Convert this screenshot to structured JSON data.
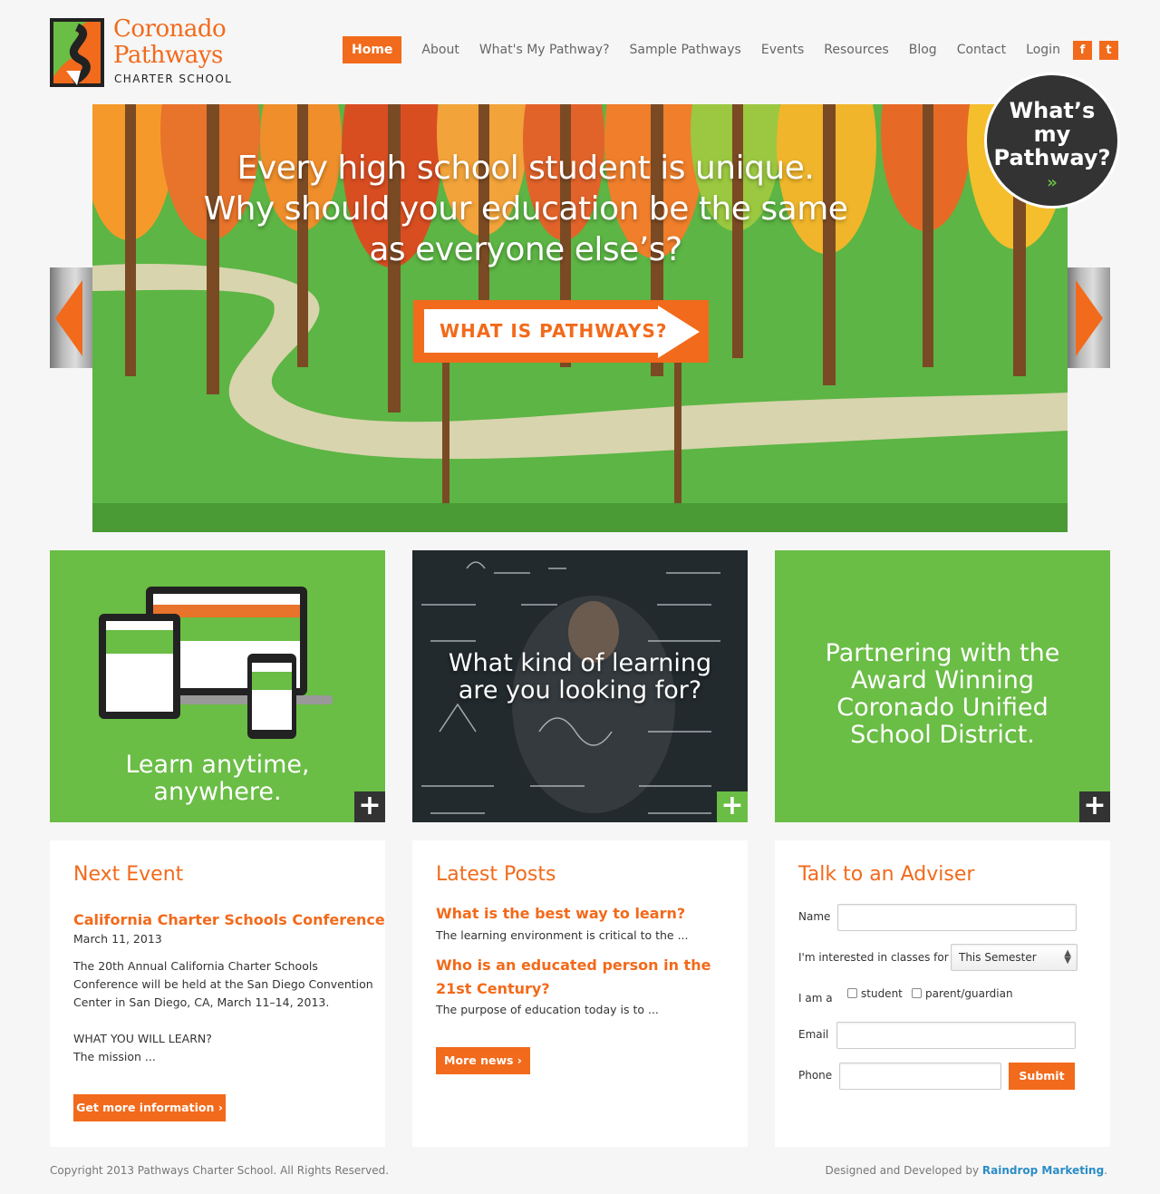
{
  "logo": {
    "line1": "Coronado",
    "line2": "Pathways",
    "line3": "CHARTER SCHOOL"
  },
  "nav": {
    "items": [
      "Home",
      "About",
      "What's My Pathway?",
      "Sample Pathways",
      "Events",
      "Resources",
      "Blog",
      "Contact",
      "Login"
    ],
    "social": [
      "f",
      "t"
    ]
  },
  "hero": {
    "headline": [
      "Every high school student is unique.",
      "Why should your education be the same",
      "as everyone else’s?"
    ],
    "cta": "WHAT IS PATHWAYS?"
  },
  "badge": {
    "lines": [
      "What’s",
      "my",
      "Pathway?"
    ],
    "arrows": "»"
  },
  "tiles": [
    {
      "caption": [
        "Learn anytime,",
        "anywhere."
      ],
      "plus": "+"
    },
    {
      "caption": [
        "What kind of learning",
        "are you looking for?"
      ],
      "plus": "+"
    },
    {
      "caption": [
        "Partnering with the",
        "Award Winning",
        "Coronado Unified",
        "School District."
      ],
      "plus": "+"
    }
  ],
  "next_event": {
    "heading": "Next Event",
    "title": "California Charter Schools Conference",
    "date": "March 11, 2013",
    "body": "The 20th Annual California Charter Schools Conference will be held at the San Diego Convention Center in San Diego, CA, March 11–14, 2013.",
    "extra1": "WHAT YOU WILL LEARN?",
    "extra2": "The mission ...",
    "button": "Get more information ›"
  },
  "latest_posts": {
    "heading": "Latest Posts",
    "posts": [
      {
        "title": "What is the best way to learn?",
        "excerpt": "The learning environment is critical to the ..."
      },
      {
        "title": "Who is an educated person in the 21st Century?",
        "excerpt": "The purpose of education today is to ..."
      }
    ],
    "button": "More news ›"
  },
  "adviser": {
    "heading": "Talk to an Adviser",
    "name_label": "Name",
    "classes_label": "I'm interested in classes for",
    "classes_value": "This Semester",
    "iam_label": "I am a",
    "opt_student": "student",
    "opt_parent": "parent/guardian",
    "email_label": "Email",
    "phone_label": "Phone",
    "submit": "Submit"
  },
  "footer": {
    "copyright": "Copyright 2013 Pathways Charter School. All Rights Reserved.",
    "credit_prefix": "Designed and Developed by ",
    "credit_link": "Raindrop Marketing",
    "credit_suffix": "."
  },
  "colors": {
    "orange": "#f26a1b",
    "green": "#6abd45",
    "dark": "#333333",
    "link": "#2a8dc6"
  }
}
